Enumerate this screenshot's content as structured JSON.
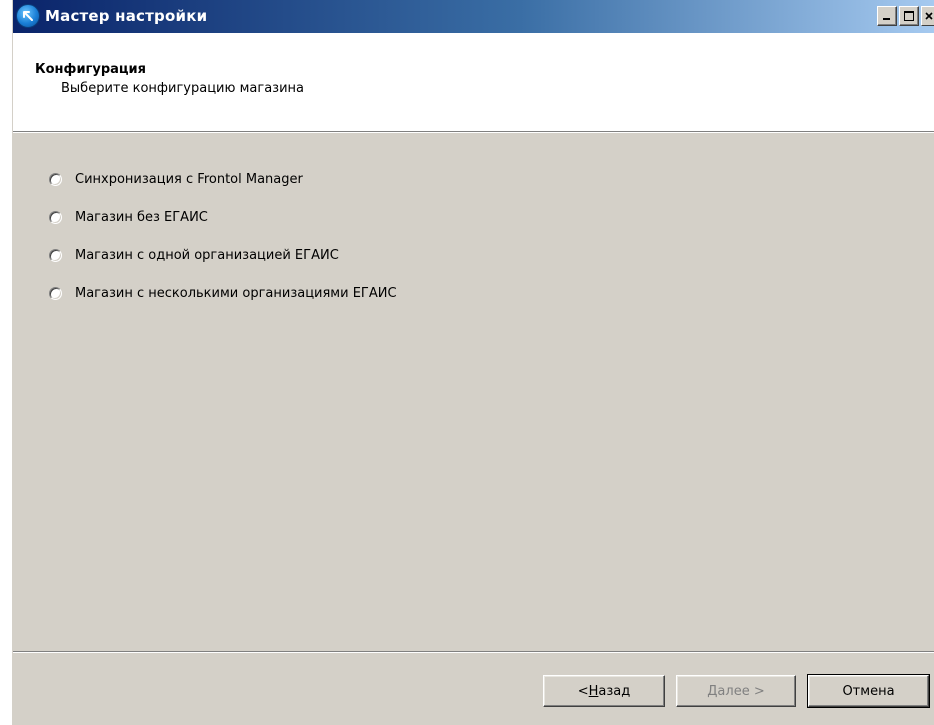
{
  "window": {
    "title": "Мастер настройки"
  },
  "header": {
    "title": "Конфигурация",
    "subtitle": "Выберите конфигурацию магазина"
  },
  "options": [
    {
      "label": "Синхронизация с Frontol Manager",
      "selected": false
    },
    {
      "label": "Магазин без ЕГАИС",
      "selected": false
    },
    {
      "label": "Магазин с одной организацией ЕГАИС",
      "selected": false
    },
    {
      "label": "Магазин с несколькими организациями ЕГАИС",
      "selected": false
    }
  ],
  "buttons": {
    "back_prefix": "< ",
    "back_accel": "Н",
    "back_rest": "азад",
    "next_accel": "Д",
    "next_rest": "алее >",
    "next_enabled": false,
    "cancel": "Отмена"
  },
  "icons": {
    "app": "app-wizard-icon",
    "minimize": "minimize-icon",
    "maximize": "maximize-icon",
    "close": "close-icon"
  }
}
